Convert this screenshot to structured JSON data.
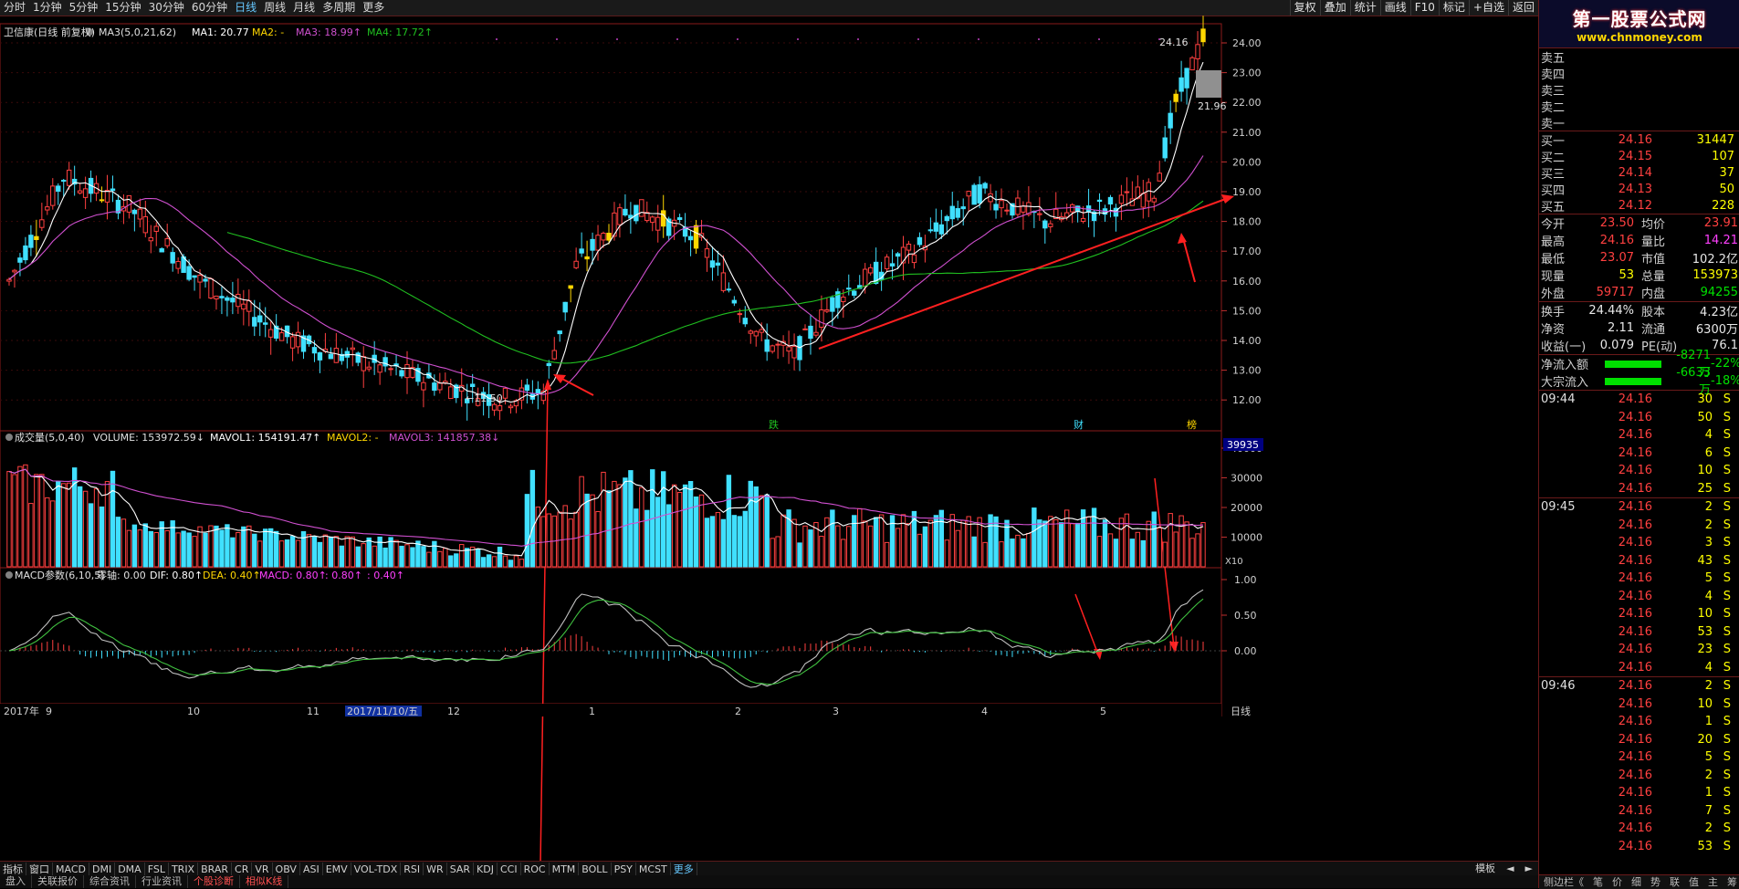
{
  "toolbar": {
    "timeframes": [
      "分时",
      "1分钟",
      "5分钟",
      "15分钟",
      "30分钟",
      "60分钟",
      "日线",
      "周线",
      "月线",
      "多周期",
      "更多"
    ],
    "active": "日线",
    "right_buttons": [
      "复权",
      "叠加",
      "统计",
      "画线",
      "F10",
      "标记",
      "+自选",
      "返回"
    ]
  },
  "main_header": {
    "name": "卫信康(日线 前复权)",
    "ma3": "MA3(5,0,21,62)",
    "ma1": "MA1: 20.77",
    "ma2": "MA2: -",
    "ma3v": "MA3: 18.99↑",
    "ma4": "MA4: 17.72↑"
  },
  "vol_header": {
    "name": "成交量(5,0,40)",
    "volume": "VOLUME: 153972.59↓",
    "mavol1": "MAVOL1: 154191.47↑",
    "mavol2": "MAVOL2: -",
    "mavol3": "MAVOL3: 141857.38↓"
  },
  "macd_header": {
    "name": "MACD参数(6,10,5)",
    "zero": "零轴: 0.00",
    "dif": "DIF: 0.80↑",
    "dea": "DEA: 0.40↑",
    "macd": "MACD: 0.80↑",
    "x1": ": 0.80↑",
    "x2": ": 0.40↑"
  },
  "price_axis": [
    "24.00",
    "23.00",
    "22.00",
    "21.00",
    "20.00",
    "19.00",
    "18.00",
    "17.00",
    "16.00",
    "15.00",
    "14.00",
    "13.00",
    "12.00"
  ],
  "vol_axis": [
    "40000",
    "30000",
    "20000",
    "10000"
  ],
  "vol_axis_top": "39935",
  "vol_axis_unit": "X10",
  "macd_axis": [
    "1.00",
    "0.50",
    "0.00"
  ],
  "annotations": {
    "high_label": "24.16",
    "low_label": "11.50",
    "last_label": "21.96",
    "event1": "跌",
    "event2": "财",
    "event3": "榜"
  },
  "date_axis": {
    "labels": [
      "2017年",
      "9",
      "10",
      "11",
      "2017/11/10/五",
      "12",
      "1",
      "2",
      "3",
      "4",
      "5"
    ],
    "right": "日线"
  },
  "indicators": [
    "指标",
    "窗口",
    "MACD",
    "DMI",
    "DMA",
    "FSL",
    "TRIX",
    "BRAR",
    "CR",
    "VR",
    "OBV",
    "ASI",
    "EMV",
    "VOL-TDX",
    "RSI",
    "WR",
    "SAR",
    "KDJ",
    "CCI",
    "ROC",
    "MTM",
    "BOLL",
    "PSY",
    "MCST",
    "更多"
  ],
  "bottom_right": [
    "模板",
    "◄",
    "►"
  ],
  "tabs": [
    "盘入",
    "关联报价",
    "综合资讯",
    "行业资讯",
    "个股诊断",
    "相似K线"
  ],
  "hot_tabs": [
    "个股诊断",
    "相似K线"
  ],
  "side": {
    "banner_title": "第一股票公式网",
    "banner_url": "www.chnmoney.com",
    "sell_labels": [
      "卖五",
      "卖四",
      "卖三",
      "卖二",
      "卖一"
    ],
    "buy": [
      {
        "label": "买一",
        "price": "24.16",
        "vol": "31447"
      },
      {
        "label": "买二",
        "price": "24.15",
        "vol": "107"
      },
      {
        "label": "买三",
        "price": "24.14",
        "vol": "37"
      },
      {
        "label": "买四",
        "price": "24.13",
        "vol": "50"
      },
      {
        "label": "买五",
        "price": "24.12",
        "vol": "228"
      }
    ],
    "quote": [
      {
        "l1": "今开",
        "v1": "23.50",
        "c1": "red",
        "l2": "均价",
        "v2": "23.91",
        "c2": "red"
      },
      {
        "l1": "最高",
        "v1": "24.16",
        "c1": "red",
        "l2": "量比",
        "v2": "14.21",
        "c2": "mag"
      },
      {
        "l1": "最低",
        "v1": "23.07",
        "c1": "red",
        "l2": "市值",
        "v2": "102.2亿",
        "c2": "wht"
      },
      {
        "l1": "现量",
        "v1": "53",
        "c1": "yel",
        "l2": "总量",
        "v2": "153973",
        "c2": "yel"
      },
      {
        "l1": "外盘",
        "v1": "59717",
        "c1": "red",
        "l2": "内盘",
        "v2": "94255",
        "c2": "grn"
      }
    ],
    "quote2": [
      {
        "l1": "换手",
        "v1": "24.44%",
        "c1": "wht",
        "l2": "股本",
        "v2": "4.23亿",
        "c2": "wht"
      },
      {
        "l1": "净资",
        "v1": "2.11",
        "c1": "wht",
        "l2": "流通",
        "v2": "6300万",
        "c2": "wht"
      },
      {
        "l1": "收益(一)",
        "v1": "0.079",
        "c1": "wht",
        "l2": "PE(动)",
        "v2": "76.1",
        "c2": "wht"
      }
    ],
    "flows": [
      {
        "label": "净流入额",
        "value": "-8271万",
        "pct": "-22%"
      },
      {
        "label": "大宗流入",
        "value": "-6633万",
        "pct": "-18%"
      }
    ],
    "ticks": [
      {
        "t": "09:44",
        "p": "24.16",
        "v": "30",
        "s": "S"
      },
      {
        "t": "",
        "p": "24.16",
        "v": "50",
        "s": "S"
      },
      {
        "t": "",
        "p": "24.16",
        "v": "4",
        "s": "S"
      },
      {
        "t": "",
        "p": "24.16",
        "v": "6",
        "s": "S"
      },
      {
        "t": "",
        "p": "24.16",
        "v": "10",
        "s": "S"
      },
      {
        "t": "",
        "p": "24.16",
        "v": "25",
        "s": "S"
      },
      {
        "t": "09:45",
        "p": "24.16",
        "v": "2",
        "s": "S"
      },
      {
        "t": "",
        "p": "24.16",
        "v": "2",
        "s": "S"
      },
      {
        "t": "",
        "p": "24.16",
        "v": "3",
        "s": "S"
      },
      {
        "t": "",
        "p": "24.16",
        "v": "43",
        "s": "S"
      },
      {
        "t": "",
        "p": "24.16",
        "v": "5",
        "s": "S"
      },
      {
        "t": "",
        "p": "24.16",
        "v": "4",
        "s": "S"
      },
      {
        "t": "",
        "p": "24.16",
        "v": "10",
        "s": "S"
      },
      {
        "t": "",
        "p": "24.16",
        "v": "53",
        "s": "S"
      },
      {
        "t": "",
        "p": "24.16",
        "v": "23",
        "s": "S"
      },
      {
        "t": "",
        "p": "24.16",
        "v": "4",
        "s": "S"
      },
      {
        "t": "09:46",
        "p": "24.16",
        "v": "2",
        "s": "S"
      },
      {
        "t": "",
        "p": "24.16",
        "v": "10",
        "s": "S"
      },
      {
        "t": "",
        "p": "24.16",
        "v": "1",
        "s": "S"
      },
      {
        "t": "",
        "p": "24.16",
        "v": "20",
        "s": "S"
      },
      {
        "t": "",
        "p": "24.16",
        "v": "5",
        "s": "S"
      },
      {
        "t": "",
        "p": "24.16",
        "v": "2",
        "s": "S"
      },
      {
        "t": "",
        "p": "24.16",
        "v": "1",
        "s": "S"
      },
      {
        "t": "",
        "p": "24.16",
        "v": "7",
        "s": "S"
      },
      {
        "t": "",
        "p": "24.16",
        "v": "2",
        "s": "S"
      },
      {
        "t": "",
        "p": "24.16",
        "v": "53",
        "s": "S"
      }
    ],
    "bottom_tabs": [
      "侧边栏《",
      "笔",
      "价",
      "细",
      "势",
      "联",
      "值",
      "主",
      "筹"
    ]
  },
  "colors": {
    "up": "#ff4040",
    "down": "#40e0ff",
    "limit": "#ffd700",
    "ma5": "#ffffff",
    "ma21": "#d050d0",
    "ma62": "#20c020"
  }
}
